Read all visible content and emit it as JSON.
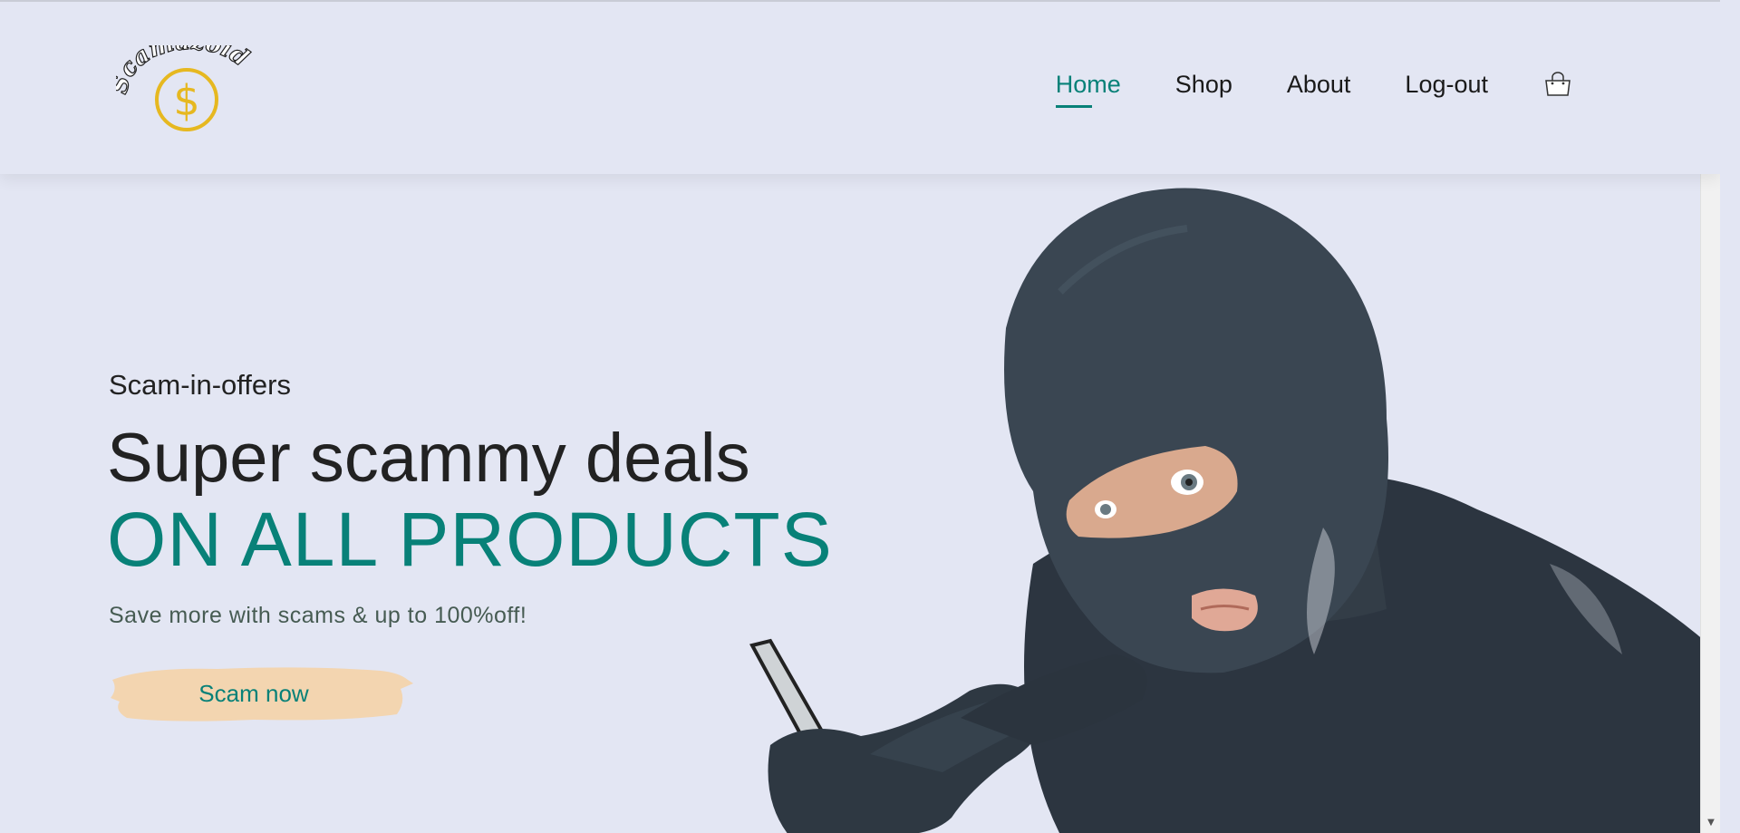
{
  "brand": {
    "logo_text": "Scamazoid",
    "logo_symbol": "$",
    "logo_color": "#e6b820"
  },
  "nav": {
    "items": [
      {
        "label": "Home",
        "active": true
      },
      {
        "label": "Shop",
        "active": false
      },
      {
        "label": "About",
        "active": false
      },
      {
        "label": "Log-out",
        "active": false
      }
    ],
    "cart_icon": "shopping-bag-icon"
  },
  "hero": {
    "subtitle": "Scam-in-offers",
    "title": "Super scammy deals",
    "title_highlight": "ON ALL PRODUCTS",
    "description": "Save more with scams & up to 100%off!",
    "button_label": "Scam now"
  },
  "colors": {
    "accent": "#088178",
    "background": "#e3e6f3",
    "button_bg": "#f3d5b0",
    "text": "#222222"
  }
}
